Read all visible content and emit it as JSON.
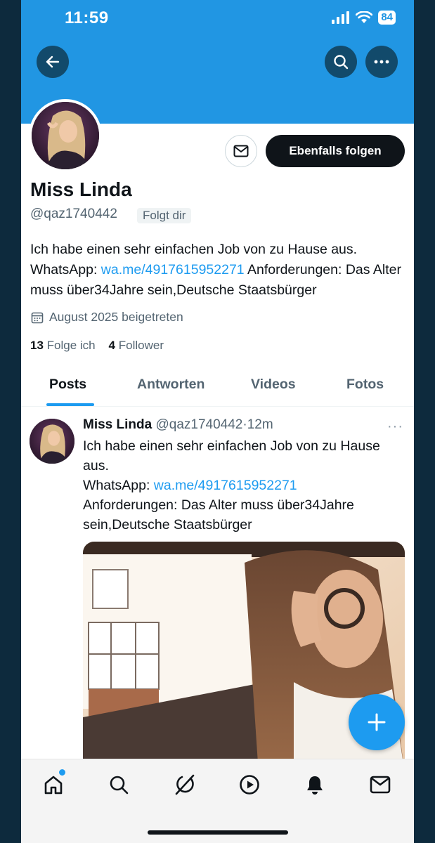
{
  "status_bar": {
    "time": "11:59",
    "battery": "84"
  },
  "header": {
    "back_icon": "arrow-left-icon",
    "search_icon": "search-icon",
    "more_icon": "more-horizontal-icon"
  },
  "profile": {
    "name": "Miss Linda",
    "handle": "@qaz1740442",
    "follows_you": "Folgt dir",
    "follow_button": "Ebenfalls folgen",
    "bio_part1": "Ich habe einen sehr einfachen Job von zu Hause aus. WhatsApp: ",
    "bio_link": "wa.me/4917615952271",
    "bio_part2": " Anforderungen: Das Alter muss über34Jahre sein,Deutsche Staatsbürger",
    "joined": "August 2025 beigetreten",
    "following_count": "13",
    "following_label": "Folge ich",
    "followers_count": "4",
    "followers_label": "Follower"
  },
  "tabs": [
    {
      "label": "Posts",
      "active": true
    },
    {
      "label": "Antworten"
    },
    {
      "label": "Videos"
    },
    {
      "label": "Fotos"
    }
  ],
  "post": {
    "name": "Miss Linda",
    "handle": "@qaz1740442",
    "separator": "·",
    "time": "12m",
    "more": "···",
    "line1": "Ich habe einen sehr einfachen Job von zu Hause aus.",
    "whatsapp_label": "WhatsApp: ",
    "link": "wa.me/4917615952271",
    "line3": "Anforderungen: Das Alter muss über34Jahre sein,Deutsche Staatsbürger"
  },
  "colors": {
    "banner": "#2196e3",
    "accent": "#1d9bf0",
    "text": "#0f1419",
    "muted": "#536471"
  }
}
